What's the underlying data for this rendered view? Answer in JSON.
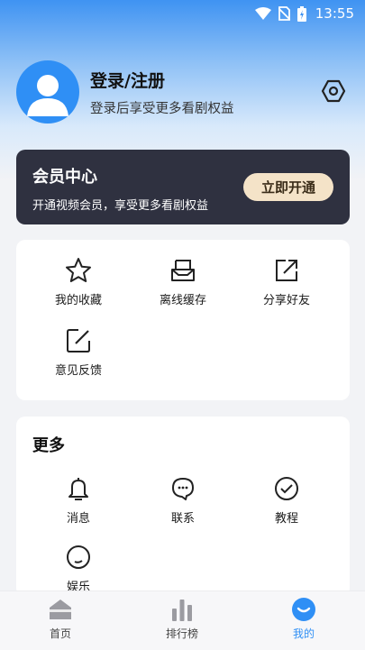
{
  "status_bar": {
    "time": "13:55"
  },
  "profile": {
    "title": "登录/注册",
    "subtitle": "登录后享受更多看剧权益"
  },
  "vip": {
    "title": "会员中心",
    "subtitle": "开通视频会员，享受更多看剧权益",
    "button": "立即开通"
  },
  "features": [
    {
      "label": "我的收藏",
      "icon": "star-icon"
    },
    {
      "label": "离线缓存",
      "icon": "download-tray-icon"
    },
    {
      "label": "分享好友",
      "icon": "share-icon"
    },
    {
      "label": "意见反馈",
      "icon": "edit-feedback-icon"
    }
  ],
  "more": {
    "title": "更多",
    "items": [
      {
        "label": "消息",
        "icon": "bell-icon"
      },
      {
        "label": "联系",
        "icon": "chat-icon"
      },
      {
        "label": "教程",
        "icon": "check-circle-icon"
      },
      {
        "label": "娱乐",
        "icon": "smile-circle-icon"
      }
    ]
  },
  "tabs": [
    {
      "label": "首页",
      "icon": "home-icon"
    },
    {
      "label": "排行榜",
      "icon": "ranking-bars-icon"
    },
    {
      "label": "我的",
      "icon": "profile-face-icon",
      "active": true
    }
  ],
  "colors": {
    "accent": "#2f8ff5",
    "vip_card": "#2f3140",
    "vip_button": "#f4e3c8"
  }
}
